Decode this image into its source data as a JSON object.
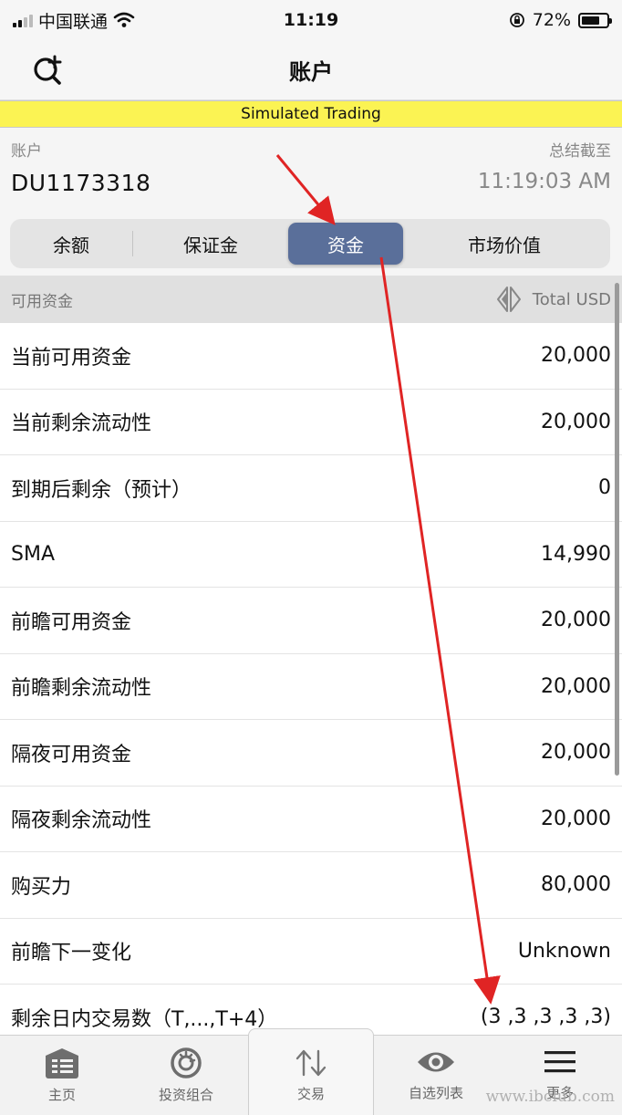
{
  "status": {
    "carrier": "中国联通",
    "time": "11:19",
    "battery": "72%",
    "battery_level": 0.72
  },
  "header": {
    "title": "账户"
  },
  "banner": {
    "text": "Simulated Trading"
  },
  "account": {
    "label": "账户",
    "id": "DU1173318",
    "asof_label": "总结截至",
    "asof_time": "11:19:03 AM"
  },
  "segments": {
    "items": [
      {
        "label": "余额"
      },
      {
        "label": "保证金"
      },
      {
        "label": "资金",
        "active": true
      },
      {
        "label": "市场价值"
      }
    ]
  },
  "list": {
    "header_label": "可用资金",
    "currency": "Total USD",
    "rows": [
      {
        "label": "当前可用资金",
        "value": "20,000"
      },
      {
        "label": "当前剩余流动性",
        "value": "20,000"
      },
      {
        "label": "到期后剩余（预计）",
        "value": "0"
      },
      {
        "label": "SMA",
        "value": "14,990"
      },
      {
        "label": "前瞻可用资金",
        "value": "20,000"
      },
      {
        "label": "前瞻剩余流动性",
        "value": "20,000"
      },
      {
        "label": "隔夜可用资金",
        "value": "20,000"
      },
      {
        "label": "隔夜剩余流动性",
        "value": "20,000"
      },
      {
        "label": "购买力",
        "value": "80,000"
      },
      {
        "label": "前瞻下一变化",
        "value": "Unknown"
      },
      {
        "label": "剩余日内交易数（T,...,T+4）",
        "value": "(3 ,3 ,3 ,3 ,3)"
      }
    ]
  },
  "tabbar": {
    "items": [
      {
        "label": "主页",
        "icon": "home-grid-icon"
      },
      {
        "label": "投资组合",
        "icon": "portfolio-dial-icon"
      },
      {
        "label": "交易",
        "icon": "trade-arrows-icon"
      },
      {
        "label": "自选列表",
        "icon": "eye-icon"
      },
      {
        "label": "更多",
        "icon": "hamburger-menu-icon"
      }
    ]
  },
  "watermark": "www.ibclub.com",
  "colors": {
    "banner": "#fbf353",
    "active_segment": "#5a6f9a",
    "annotation": "#e02424"
  }
}
